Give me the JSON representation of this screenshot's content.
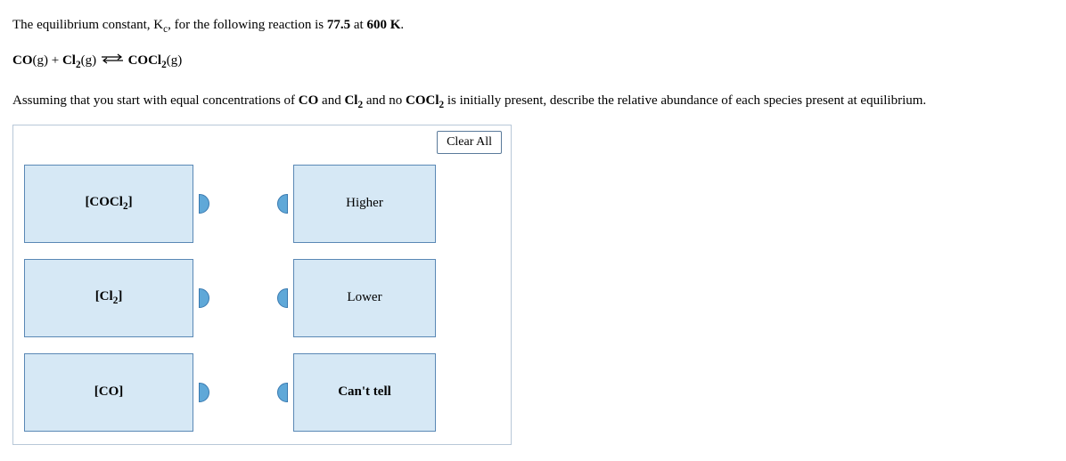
{
  "question": {
    "intro_prefix": "The equilibrium constant, K",
    "intro_sub": "c",
    "intro_suffix": ", for the following reaction is ",
    "kc_value": "77.5",
    "temp_prefix": " at ",
    "temp_value": "600 K",
    "temp_suffix": "."
  },
  "reaction": {
    "r1": "CO",
    "r1_phase": "(g)",
    "plus": " + ",
    "r2_a": "Cl",
    "r2_sub": "2",
    "r2_phase": "(g)",
    "arrow": "⇌",
    "p1_a": "COCl",
    "p1_sub": "2",
    "p1_phase": "(g)"
  },
  "instruction": {
    "p1": "Assuming that you start with equal concentrations of ",
    "s1": "CO",
    "p2": " and ",
    "s2a": "Cl",
    "s2sub": "2",
    "p3": " and no ",
    "s3a": "COCl",
    "s3sub": "2",
    "p4": " is initially present, describe the relative abundance of each species present at equilibrium."
  },
  "toolbar": {
    "clear_label": "Clear All"
  },
  "left_tiles": [
    {
      "pre": "[COCl",
      "sub": "2",
      "post": "]"
    },
    {
      "pre": "[Cl",
      "sub": "2",
      "post": "]"
    },
    {
      "pre": "[CO]",
      "sub": "",
      "post": ""
    }
  ],
  "right_tiles": [
    {
      "label": "Higher",
      "bold": false
    },
    {
      "label": "Lower",
      "bold": false
    },
    {
      "label": "Can't tell",
      "bold": true
    }
  ]
}
